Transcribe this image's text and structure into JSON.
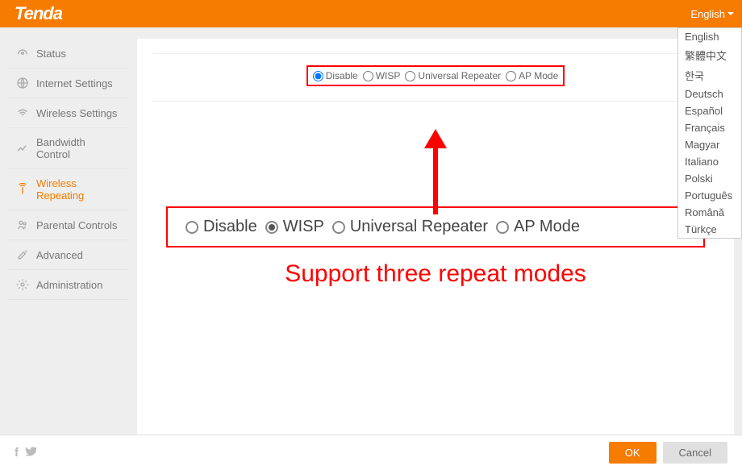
{
  "brand": "Tenda",
  "lang_current": "English",
  "languages": [
    "English",
    "繁體中文",
    "한국",
    "Deutsch",
    "Español",
    "Français",
    "Magyar",
    "Italiano",
    "Polski",
    "Português",
    "Română",
    "Türkçe"
  ],
  "sidebar": {
    "items": [
      {
        "label": "Status"
      },
      {
        "label": "Internet Settings"
      },
      {
        "label": "Wireless Settings"
      },
      {
        "label": "Bandwidth Control"
      },
      {
        "label": "Wireless Repeating"
      },
      {
        "label": "Parental Controls"
      },
      {
        "label": "Advanced"
      },
      {
        "label": "Administration"
      }
    ]
  },
  "modes": {
    "disable": "Disable",
    "wisp": "WISP",
    "universal": "Universal Repeater",
    "ap": "AP Mode"
  },
  "big_modes": {
    "disable": "Disable",
    "wisp": "WISP",
    "universal": "Universal Repeater",
    "ap": "AP Mode"
  },
  "annotation": "Support three repeat modes",
  "buttons": {
    "ok": "OK",
    "cancel": "Cancel"
  }
}
